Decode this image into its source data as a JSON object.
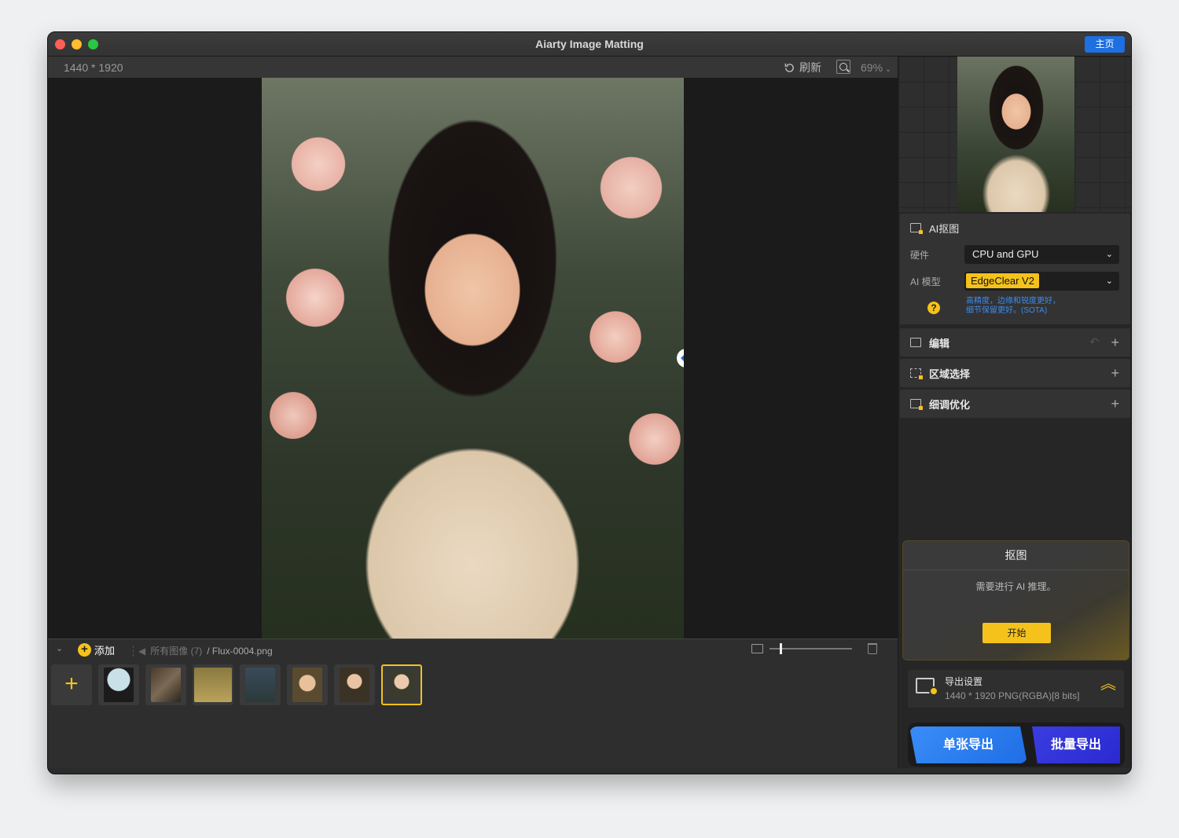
{
  "window": {
    "title": "Aiarty Image Matting",
    "home_label": "主页"
  },
  "toolbar": {
    "dimensions": "1440 * 1920",
    "refresh_label": "刷新",
    "zoom": "69%"
  },
  "bottom": {
    "add_label": "添加",
    "breadcrumb_all": "所有图像 (7)",
    "breadcrumb_current": "/ Flux-0004.png",
    "thumbnail_size_pct": 12,
    "thumbnails": [
      {
        "name": "jellyfish",
        "selected": false
      },
      {
        "name": "forest-ruins",
        "selected": false
      },
      {
        "name": "bicycle",
        "selected": false
      },
      {
        "name": "woman-red-dress",
        "selected": false
      },
      {
        "name": "girl-bouquet",
        "selected": false
      },
      {
        "name": "woman-flowers",
        "selected": false
      },
      {
        "name": "flux-0004",
        "selected": true
      }
    ]
  },
  "panel": {
    "ai_matting": {
      "title": "AI抠图",
      "hardware_label": "硬件",
      "hardware_value": "CPU and GPU",
      "model_label": "AI 模型",
      "model_value": "EdgeClear  V2",
      "hint_line1": "高精度，边缘和锐度更好，",
      "hint_line2": "细节保留更好。(SOTA)"
    },
    "edit": {
      "title": "编辑"
    },
    "region": {
      "title": "区域选择"
    },
    "refine": {
      "title": "细调优化"
    },
    "matting_box": {
      "title": "抠图",
      "message": "需要进行 AI 推理。",
      "start_label": "开始"
    },
    "export": {
      "title": "导出设置",
      "info": "1440 * 1920 PNG(RGBA)[8 bits]",
      "single_label": "单张导出",
      "batch_label": "批量导出"
    }
  },
  "colors": {
    "accent": "#f5c21b",
    "primary_blue": "#1e6fe0",
    "batch_blue": "#2f30d8"
  }
}
